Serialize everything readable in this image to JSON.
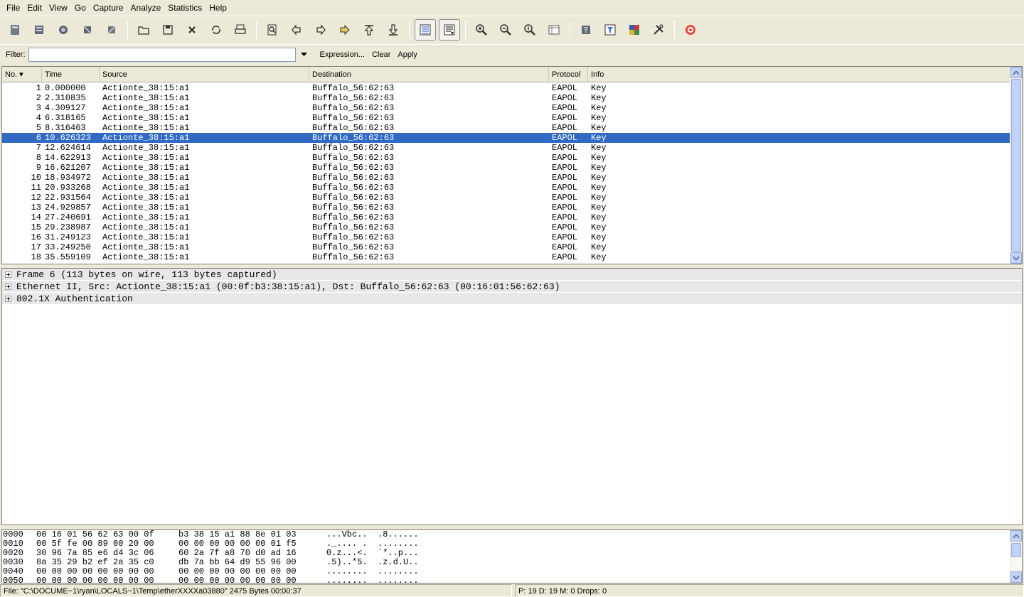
{
  "menu": [
    "File",
    "Edit",
    "View",
    "Go",
    "Capture",
    "Analyze",
    "Statistics",
    "Help"
  ],
  "toolbar": {
    "buttons": [
      {
        "name": "interfaces-icon"
      },
      {
        "name": "capture-options-icon"
      },
      {
        "name": "start-capture-icon"
      },
      {
        "name": "stop-capture-icon"
      },
      {
        "name": "restart-capture-icon"
      },
      {
        "sep": true
      },
      {
        "name": "open-file-icon"
      },
      {
        "name": "save-file-icon"
      },
      {
        "name": "close-file-icon"
      },
      {
        "name": "reload-icon"
      },
      {
        "name": "print-icon"
      },
      {
        "sep": true
      },
      {
        "name": "find-packet-icon"
      },
      {
        "name": "go-back-icon"
      },
      {
        "name": "go-forward-icon"
      },
      {
        "name": "go-to-packet-icon"
      },
      {
        "name": "go-first-icon"
      },
      {
        "name": "go-last-icon"
      },
      {
        "sep": true
      },
      {
        "name": "colorize-icon",
        "pressed": true
      },
      {
        "name": "auto-scroll-icon",
        "pressed": true
      },
      {
        "sep": true
      },
      {
        "name": "zoom-in-icon"
      },
      {
        "name": "zoom-out-icon"
      },
      {
        "name": "zoom-normal-icon"
      },
      {
        "name": "resize-columns-icon"
      },
      {
        "sep": true
      },
      {
        "name": "capture-filters-icon"
      },
      {
        "name": "display-filters-icon"
      },
      {
        "name": "coloring-rules-icon"
      },
      {
        "name": "preferences-icon"
      },
      {
        "sep": true
      },
      {
        "name": "help-icon"
      }
    ]
  },
  "filter": {
    "label": "Filter:",
    "value": "",
    "expression": "Expression...",
    "clear": "Clear",
    "apply": "Apply"
  },
  "packet_list": {
    "columns": [
      "No. ▾",
      "Time",
      "Source",
      "Destination",
      "Protocol",
      "Info"
    ],
    "selected_index": 5,
    "rows": [
      {
        "no": "1",
        "time": "0.000000",
        "src": "Actionte_38:15:a1",
        "dst": "Buffalo_56:62:63",
        "proto": "EAPOL",
        "info": "Key"
      },
      {
        "no": "2",
        "time": "2.310835",
        "src": "Actionte_38:15:a1",
        "dst": "Buffalo_56:62:63",
        "proto": "EAPOL",
        "info": "Key"
      },
      {
        "no": "3",
        "time": "4.309127",
        "src": "Actionte_38:15:a1",
        "dst": "Buffalo_56:62:63",
        "proto": "EAPOL",
        "info": "Key"
      },
      {
        "no": "4",
        "time": "6.318165",
        "src": "Actionte_38:15:a1",
        "dst": "Buffalo_56:62:63",
        "proto": "EAPOL",
        "info": "Key"
      },
      {
        "no": "5",
        "time": "8.316463",
        "src": "Actionte_38:15:a1",
        "dst": "Buffalo_56:62:63",
        "proto": "EAPOL",
        "info": "Key"
      },
      {
        "no": "6",
        "time": "10.626323",
        "src": "Actionte_38:15:a1",
        "dst": "Buffalo_56:62:63",
        "proto": "EAPOL",
        "info": "Key"
      },
      {
        "no": "7",
        "time": "12.624614",
        "src": "Actionte_38:15:a1",
        "dst": "Buffalo_56:62:63",
        "proto": "EAPOL",
        "info": "Key"
      },
      {
        "no": "8",
        "time": "14.622913",
        "src": "Actionte_38:15:a1",
        "dst": "Buffalo_56:62:63",
        "proto": "EAPOL",
        "info": "Key"
      },
      {
        "no": "9",
        "time": "16.621207",
        "src": "Actionte_38:15:a1",
        "dst": "Buffalo_56:62:63",
        "proto": "EAPOL",
        "info": "Key"
      },
      {
        "no": "10",
        "time": "18.934972",
        "src": "Actionte_38:15:a1",
        "dst": "Buffalo_56:62:63",
        "proto": "EAPOL",
        "info": "Key"
      },
      {
        "no": "11",
        "time": "20.933268",
        "src": "Actionte_38:15:a1",
        "dst": "Buffalo_56:62:63",
        "proto": "EAPOL",
        "info": "Key"
      },
      {
        "no": "12",
        "time": "22.931564",
        "src": "Actionte_38:15:a1",
        "dst": "Buffalo_56:62:63",
        "proto": "EAPOL",
        "info": "Key"
      },
      {
        "no": "13",
        "time": "24.929857",
        "src": "Actionte_38:15:a1",
        "dst": "Buffalo_56:62:63",
        "proto": "EAPOL",
        "info": "Key"
      },
      {
        "no": "14",
        "time": "27.240691",
        "src": "Actionte_38:15:a1",
        "dst": "Buffalo_56:62:63",
        "proto": "EAPOL",
        "info": "Key"
      },
      {
        "no": "15",
        "time": "29.238987",
        "src": "Actionte_38:15:a1",
        "dst": "Buffalo_56:62:63",
        "proto": "EAPOL",
        "info": "Key"
      },
      {
        "no": "16",
        "time": "31.249123",
        "src": "Actionte_38:15:a1",
        "dst": "Buffalo_56:62:63",
        "proto": "EAPOL",
        "info": "Key"
      },
      {
        "no": "17",
        "time": "33.249250",
        "src": "Actionte_38:15:a1",
        "dst": "Buffalo_56:62:63",
        "proto": "EAPOL",
        "info": "Key"
      },
      {
        "no": "18",
        "time": "35.559109",
        "src": "Actionte_38:15:a1",
        "dst": "Buffalo_56:62:63",
        "proto": "EAPOL",
        "info": "Key"
      }
    ]
  },
  "details": [
    "Frame 6 (113 bytes on wire, 113 bytes captured)",
    "Ethernet II, Src: Actionte_38:15:a1 (00:0f:b3:38:15:a1), Dst: Buffalo_56:62:63 (00:16:01:56:62:63)",
    "802.1X Authentication"
  ],
  "bytes": [
    {
      "off": "0000",
      "hex1": "00 16 01 56 62 63 00 0f",
      "hex2": "b3 38 15 a1 88 8e 01 03",
      "asc1": "...Vbc..",
      "asc2": ".8......"
    },
    {
      "off": "0010",
      "hex1": "00 5f fe 00 89 00 20 00",
      "hex2": "00 00 00 00 00 00 01 f5",
      "asc1": "._.... .",
      "asc2": "........"
    },
    {
      "off": "0020",
      "hex1": "30 96 7a 85 e6 d4 3c 06",
      "hex2": "60 2a 7f a8 70 d0 ad 16",
      "asc1": "0.z...<.",
      "asc2": "`*..p..."
    },
    {
      "off": "0030",
      "hex1": "8a 35 29 b2 ef 2a 35 c0",
      "hex2": "db 7a bb 64 d9 55 96 00",
      "asc1": ".5)..*5.",
      "asc2": ".z.d.U.."
    },
    {
      "off": "0040",
      "hex1": "00 00 00 00 00 00 00 00",
      "hex2": "00 00 00 00 00 00 00 00",
      "asc1": "........",
      "asc2": "........"
    },
    {
      "off": "0050",
      "hex1": "00 00 00 00 00 00 00 00",
      "hex2": "00 00 00 00 00 00 00 00",
      "asc1": "........",
      "asc2": "........"
    }
  ],
  "status": {
    "file": "File: \"C:\\DOCUME~1\\ryan\\LOCALS~1\\Temp\\etherXXXXa03880\" 2475 Bytes 00:00:37",
    "counts": "P: 19 D: 19 M: 0 Drops: 0"
  },
  "colors": {
    "selection": "#316ac5",
    "chrome": "#ece9d8"
  }
}
